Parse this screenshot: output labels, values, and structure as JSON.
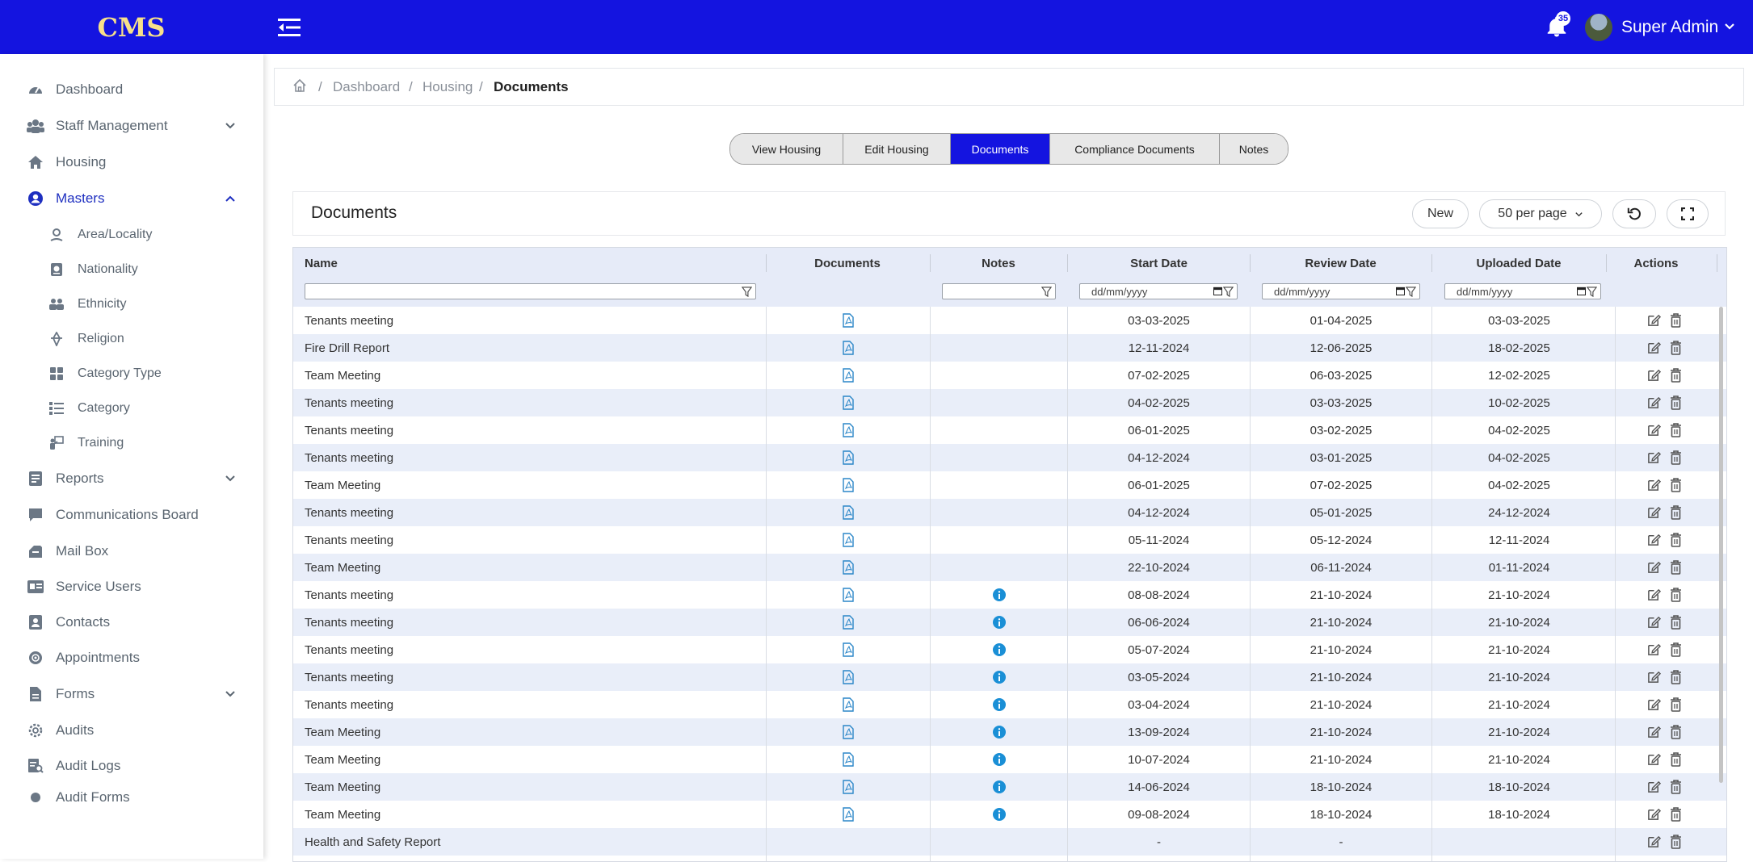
{
  "header": {
    "brand": "CMS",
    "notifications_count": "35",
    "user_name": "Super Admin"
  },
  "sidebar": {
    "items": [
      {
        "label": "Dashboard",
        "icon": "dashboard-icon"
      },
      {
        "label": "Staff Management",
        "icon": "users-icon",
        "expandable": true
      },
      {
        "label": "Housing",
        "icon": "home-icon"
      },
      {
        "label": "Masters",
        "icon": "user-circle-icon",
        "expandable": true,
        "expanded": true,
        "active": true
      },
      {
        "label": "Reports",
        "icon": "report-icon",
        "expandable": true
      },
      {
        "label": "Communications Board",
        "icon": "chat-icon"
      },
      {
        "label": "Mail Box",
        "icon": "mailbox-icon"
      },
      {
        "label": "Service Users",
        "icon": "id-card-icon"
      },
      {
        "label": "Contacts",
        "icon": "contact-icon"
      },
      {
        "label": "Appointments",
        "icon": "appointment-icon"
      },
      {
        "label": "Forms",
        "icon": "form-icon",
        "expandable": true
      },
      {
        "label": "Audits",
        "icon": "gear-icon"
      },
      {
        "label": "Audit Logs",
        "icon": "audit-log-icon"
      },
      {
        "label": "Audit Forms",
        "icon": "dot-icon"
      }
    ],
    "masters_sub": [
      {
        "label": "Area/Locality",
        "icon": "location-icon"
      },
      {
        "label": "Nationality",
        "icon": "passport-icon"
      },
      {
        "label": "Ethnicity",
        "icon": "people-icon"
      },
      {
        "label": "Religion",
        "icon": "religion-icon"
      },
      {
        "label": "Category Type",
        "icon": "grid-icon"
      },
      {
        "label": "Category",
        "icon": "list-icon"
      },
      {
        "label": "Training",
        "icon": "training-icon"
      }
    ]
  },
  "breadcrumb": {
    "items": [
      "Dashboard",
      "Housing",
      "Documents"
    ]
  },
  "tabs": [
    {
      "label": "View Housing"
    },
    {
      "label": "Edit Housing"
    },
    {
      "label": "Documents",
      "active": true
    },
    {
      "label": "Compliance Documents"
    },
    {
      "label": "Notes"
    }
  ],
  "card": {
    "title": "Documents",
    "new_label": "New",
    "per_page_label": "50 per page"
  },
  "table": {
    "columns": [
      "Name",
      "Documents",
      "Notes",
      "Start Date",
      "Review Date",
      "Uploaded Date",
      "Actions"
    ],
    "date_placeholder": "dd/mm/yyyy",
    "rows": [
      {
        "name": "Tenants meeting",
        "doc": true,
        "note": false,
        "start": "03-03-2025",
        "review": "01-04-2025",
        "uploaded": "03-03-2025"
      },
      {
        "name": "Fire Drill Report",
        "doc": true,
        "note": false,
        "start": "12-11-2024",
        "review": "12-06-2025",
        "uploaded": "18-02-2025"
      },
      {
        "name": "Team Meeting",
        "doc": true,
        "note": false,
        "start": "07-02-2025",
        "review": "06-03-2025",
        "uploaded": "12-02-2025"
      },
      {
        "name": "Tenants meeting",
        "doc": true,
        "note": false,
        "start": "04-02-2025",
        "review": "03-03-2025",
        "uploaded": "10-02-2025"
      },
      {
        "name": "Tenants meeting",
        "doc": true,
        "note": false,
        "start": "06-01-2025",
        "review": "03-02-2025",
        "uploaded": "04-02-2025"
      },
      {
        "name": "Tenants meeting",
        "doc": true,
        "note": false,
        "start": "04-12-2024",
        "review": "03-01-2025",
        "uploaded": "04-02-2025"
      },
      {
        "name": "Team Meeting",
        "doc": true,
        "note": false,
        "start": "06-01-2025",
        "review": "07-02-2025",
        "uploaded": "04-02-2025"
      },
      {
        "name": "Tenants meeting",
        "doc": true,
        "note": false,
        "start": "04-12-2024",
        "review": "05-01-2025",
        "uploaded": "24-12-2024"
      },
      {
        "name": "Tenants meeting",
        "doc": true,
        "note": false,
        "start": "05-11-2024",
        "review": "05-12-2024",
        "uploaded": "12-11-2024"
      },
      {
        "name": "Team Meeting",
        "doc": true,
        "note": false,
        "start": "22-10-2024",
        "review": "06-11-2024",
        "uploaded": "01-11-2024"
      },
      {
        "name": "Tenants meeting",
        "doc": true,
        "note": true,
        "start": "08-08-2024",
        "review": "21-10-2024",
        "uploaded": "21-10-2024"
      },
      {
        "name": "Tenants meeting",
        "doc": true,
        "note": true,
        "start": "06-06-2024",
        "review": "21-10-2024",
        "uploaded": "21-10-2024"
      },
      {
        "name": "Tenants meeting",
        "doc": true,
        "note": true,
        "start": "05-07-2024",
        "review": "21-10-2024",
        "uploaded": "21-10-2024"
      },
      {
        "name": "Tenants meeting",
        "doc": true,
        "note": true,
        "start": "03-05-2024",
        "review": "21-10-2024",
        "uploaded": "21-10-2024"
      },
      {
        "name": "Tenants meeting",
        "doc": true,
        "note": true,
        "start": "03-04-2024",
        "review": "21-10-2024",
        "uploaded": "21-10-2024"
      },
      {
        "name": "Team Meeting",
        "doc": true,
        "note": true,
        "start": "13-09-2024",
        "review": "21-10-2024",
        "uploaded": "21-10-2024"
      },
      {
        "name": "Team Meeting",
        "doc": true,
        "note": true,
        "start": "10-07-2024",
        "review": "21-10-2024",
        "uploaded": "21-10-2024"
      },
      {
        "name": "Team Meeting",
        "doc": true,
        "note": true,
        "start": "14-06-2024",
        "review": "18-10-2024",
        "uploaded": "18-10-2024"
      },
      {
        "name": "Team Meeting",
        "doc": true,
        "note": true,
        "start": "09-08-2024",
        "review": "18-10-2024",
        "uploaded": "18-10-2024"
      },
      {
        "name": "Health and Safety Report",
        "doc": false,
        "note": false,
        "start": "-",
        "review": "-",
        "uploaded": ""
      }
    ]
  },
  "colors": {
    "primary": "#1414e0",
    "brand_text": "#f7e08a",
    "row_alt": "#e9eef9",
    "info_badge": "#1a8fd6"
  }
}
